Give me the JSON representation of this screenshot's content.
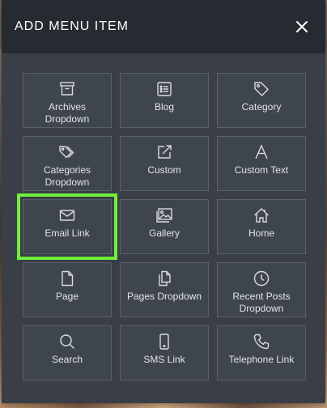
{
  "modal": {
    "title": "ADD MENU ITEM",
    "close_icon": "close-icon",
    "highlight_color": "#6ef03a"
  },
  "tiles": [
    {
      "label": "Archives\nDropdown",
      "icon": "archive-box-icon"
    },
    {
      "label": "Blog",
      "icon": "list-document-icon"
    },
    {
      "label": "Category",
      "icon": "tag-icon"
    },
    {
      "label": "Categories\nDropdown",
      "icon": "tags-icon"
    },
    {
      "label": "Custom",
      "icon": "external-link-icon"
    },
    {
      "label": "Custom Text",
      "icon": "letter-a-icon"
    },
    {
      "label": "Email Link",
      "icon": "envelope-icon",
      "highlighted": true
    },
    {
      "label": "Gallery",
      "icon": "images-icon"
    },
    {
      "label": "Home",
      "icon": "home-icon"
    },
    {
      "label": "Page",
      "icon": "page-icon"
    },
    {
      "label": "Pages Dropdown",
      "icon": "pages-icon"
    },
    {
      "label": "Recent Posts\nDropdown",
      "icon": "clock-icon"
    },
    {
      "label": "Search",
      "icon": "search-icon"
    },
    {
      "label": "SMS Link",
      "icon": "mobile-phone-icon"
    },
    {
      "label": "Telephone Link",
      "icon": "telephone-icon"
    }
  ]
}
